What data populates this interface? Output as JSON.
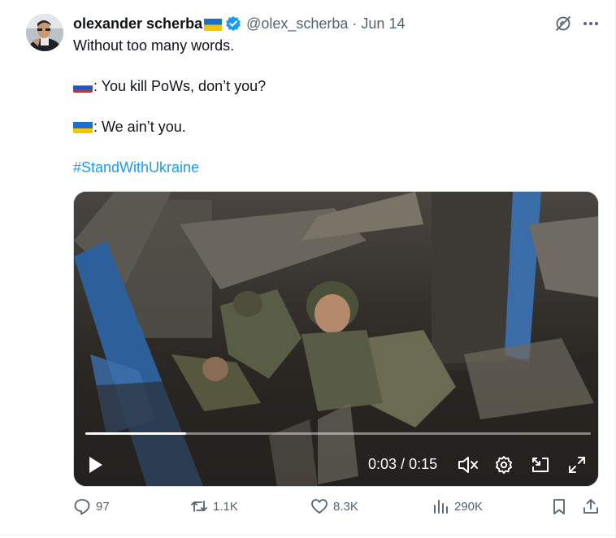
{
  "author": {
    "name": "olexander scherba",
    "handle": "@olex_scherba",
    "separator": "·",
    "date": "Jun 14",
    "name_flag": "ukraine-flag",
    "verified_color": "#1d9bf0"
  },
  "tweet": {
    "line1": "Without too many words.",
    "line2_flag": "russia-flag",
    "line2": ": You kill PoWs, don’t you?",
    "line3_flag": "ukraine-flag",
    "line3": ": We ain’t you.",
    "hashtag": "#StandWithUkraine"
  },
  "video": {
    "current_time": "0:03",
    "time_separator": " / ",
    "duration": "0:15",
    "progress": 0.2,
    "controls": [
      "play-icon",
      "mute-icon",
      "settings-icon",
      "pip-icon",
      "fullscreen-icon"
    ]
  },
  "actions": {
    "replies": "97",
    "reposts": "1.1K",
    "likes": "8.3K",
    "views": "290K"
  },
  "colors": {
    "accent": "#1d9bf0",
    "secondary_text": "#536471",
    "primary_text": "#0f1419"
  }
}
